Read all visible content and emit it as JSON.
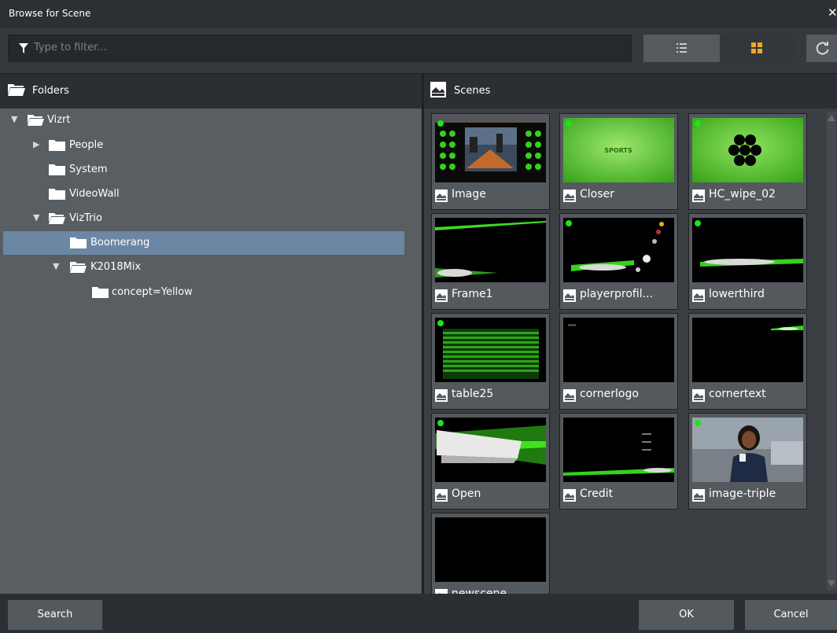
{
  "window": {
    "title": "Browse for Scene",
    "close_icon": "close-icon"
  },
  "toolbar": {
    "filter_placeholder": "Type to filter...",
    "filter_icon": "filter-funnel-icon",
    "list_view_icon": "list-view-icon",
    "grid_view_icon": "grid-view-icon",
    "refresh_icon": "refresh-icon",
    "active_view": "grid"
  },
  "folders_panel": {
    "header": "Folders",
    "tree": [
      {
        "label": "Vizrt",
        "level": 0,
        "expanded": true,
        "has_children": true
      },
      {
        "label": "People",
        "level": 1,
        "expanded": false,
        "has_children": true
      },
      {
        "label": "System",
        "level": 1,
        "expanded": false,
        "has_children": false
      },
      {
        "label": "VideoWall",
        "level": 1,
        "expanded": false,
        "has_children": false
      },
      {
        "label": "VizTrio",
        "level": 1,
        "expanded": true,
        "has_children": true
      },
      {
        "label": "Boomerang",
        "level": 2,
        "expanded": false,
        "has_children": false,
        "selected": true
      },
      {
        "label": "K2018Mix",
        "level": 2,
        "expanded": true,
        "has_children": true
      },
      {
        "label": "concept=Yellow",
        "level": 3,
        "expanded": false,
        "has_children": false
      }
    ]
  },
  "scenes_panel": {
    "header": "Scenes",
    "scenes": [
      {
        "name": "Image",
        "status": true
      },
      {
        "name": "Closer",
        "status": true
      },
      {
        "name": "HC_wipe_02",
        "status": true
      },
      {
        "name": "Frame1",
        "status": false
      },
      {
        "name": "playerprofil...",
        "status": true
      },
      {
        "name": "lowerthird",
        "status": true
      },
      {
        "name": "table25",
        "status": true
      },
      {
        "name": "cornerlogo",
        "status": false
      },
      {
        "name": "cornertext",
        "status": false
      },
      {
        "name": "Open",
        "status": true
      },
      {
        "name": "Credit",
        "status": false
      },
      {
        "name": "image-triple",
        "status": true
      },
      {
        "name": "newscene",
        "status": false
      }
    ]
  },
  "footer": {
    "search_label": "Search",
    "ok_label": "OK",
    "cancel_label": "Cancel"
  },
  "colors": {
    "accent": "#f5a623",
    "selection": "#6b87a4",
    "status_dot": "#19e619",
    "scene_green": "#39c41f"
  }
}
